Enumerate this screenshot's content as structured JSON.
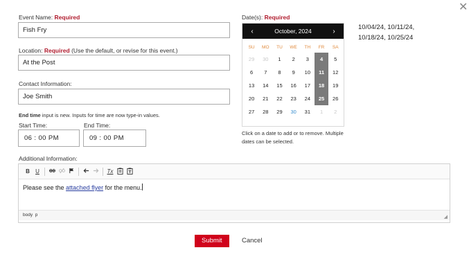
{
  "event_name": {
    "label": "Event Name:",
    "required": "Required",
    "value": "Fish Fry"
  },
  "location": {
    "label": "Location:",
    "required": "Required",
    "hint": "(Use the default, or revise for this event.)",
    "value": "At the Post"
  },
  "contact": {
    "label": "Contact Information:",
    "value": "Joe Smith"
  },
  "time_note": {
    "bold": "End time",
    "rest": " input is new. Inputs for time are now type-in values."
  },
  "start_time": {
    "label": "Start Time:",
    "value": "06 : 00  PM"
  },
  "end_time": {
    "label": "End Time:",
    "value": "09 : 00  PM"
  },
  "dates": {
    "label": "Date(s):",
    "required": "Required",
    "help_line1": "Click on a date to add or to remove. Multiple",
    "help_line2": "dates can be selected.",
    "selected_line1": "10/04/24, 10/11/24,",
    "selected_line2": "10/18/24, 10/25/24"
  },
  "calendar": {
    "title": "October, 2024",
    "prev_glyph": "‹",
    "next_glyph": "›",
    "weekdays": [
      "SU",
      "MO",
      "TU",
      "WE",
      "TH",
      "FR",
      "SA"
    ],
    "days": [
      {
        "d": "29",
        "state": "muted"
      },
      {
        "d": "30",
        "state": "muted"
      },
      {
        "d": "1",
        "state": ""
      },
      {
        "d": "2",
        "state": ""
      },
      {
        "d": "3",
        "state": ""
      },
      {
        "d": "4",
        "state": "sel"
      },
      {
        "d": "5",
        "state": ""
      },
      {
        "d": "6",
        "state": ""
      },
      {
        "d": "7",
        "state": ""
      },
      {
        "d": "8",
        "state": ""
      },
      {
        "d": "9",
        "state": ""
      },
      {
        "d": "10",
        "state": ""
      },
      {
        "d": "11",
        "state": "sel"
      },
      {
        "d": "12",
        "state": ""
      },
      {
        "d": "13",
        "state": ""
      },
      {
        "d": "14",
        "state": ""
      },
      {
        "d": "15",
        "state": ""
      },
      {
        "d": "16",
        "state": ""
      },
      {
        "d": "17",
        "state": ""
      },
      {
        "d": "18",
        "state": "sel"
      },
      {
        "d": "19",
        "state": ""
      },
      {
        "d": "20",
        "state": ""
      },
      {
        "d": "21",
        "state": ""
      },
      {
        "d": "22",
        "state": ""
      },
      {
        "d": "23",
        "state": ""
      },
      {
        "d": "24",
        "state": ""
      },
      {
        "d": "25",
        "state": "sel"
      },
      {
        "d": "26",
        "state": ""
      },
      {
        "d": "27",
        "state": ""
      },
      {
        "d": "28",
        "state": ""
      },
      {
        "d": "29",
        "state": ""
      },
      {
        "d": "30",
        "state": "today"
      },
      {
        "d": "31",
        "state": ""
      },
      {
        "d": "1",
        "state": "muted"
      },
      {
        "d": "2",
        "state": "muted"
      }
    ]
  },
  "additional": {
    "label": "Additional Information:",
    "text_before": "Please see the ",
    "link_text": "attached flyer",
    "text_after": " for the menu.",
    "status_path": "body  p"
  },
  "toolbar": {
    "bold": "B",
    "underline": "U",
    "link_icon": "link-icon",
    "unlink_icon": "unlink-icon",
    "anchor_icon": "flag-icon",
    "undo_icon": "undo-icon",
    "redo_icon": "redo-icon",
    "clear_format": "Tx",
    "paste_icon": "paste-icon",
    "paste_text_icon": "paste-text-icon"
  },
  "actions": {
    "submit": "Submit",
    "cancel": "Cancel"
  },
  "colors": {
    "required": "#b01c2e",
    "submit_bg": "#d0021b",
    "calendar_header": "#111111",
    "selected_day": "#7a7a7a",
    "weekday": "#e08a3c",
    "link": "#2a3fa0"
  }
}
